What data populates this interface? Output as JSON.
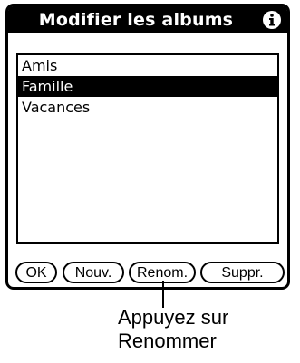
{
  "dialog": {
    "title": "Modifier les albums",
    "info_icon": "info-icon"
  },
  "list": {
    "items": [
      {
        "label": "Amis",
        "selected": false
      },
      {
        "label": "Famille",
        "selected": true
      },
      {
        "label": "Vacances",
        "selected": false
      }
    ]
  },
  "buttons": {
    "ok_label": "OK",
    "new_label": "Nouv.",
    "rename_label": "Renom.",
    "delete_label": "Suppr."
  },
  "callout": {
    "line1": "Appuyez sur",
    "line2": "Renommer"
  }
}
